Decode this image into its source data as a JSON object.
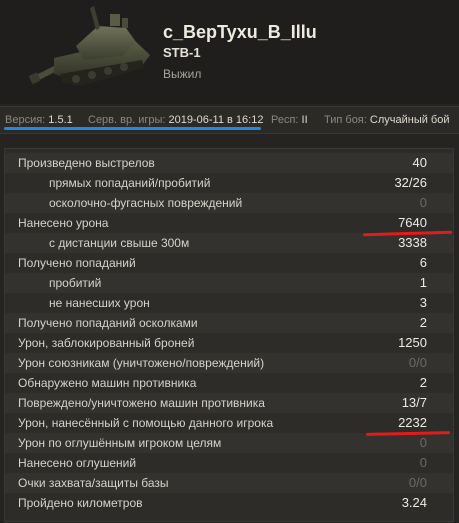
{
  "header": {
    "player_name": "c_BepTyxu_B_Illu",
    "tank_name": "STB-1",
    "status": "Выжил"
  },
  "info": {
    "version_label": "Версия:",
    "version_value": "1.5.1",
    "server_time_label": "Серв. вр. игры:",
    "server_time_value": "2019-06-11 в 16:12",
    "resp_label": "Респ:",
    "resp_value": "II",
    "battle_type_label": "Тип боя:",
    "battle_type_value": "Случайный бой"
  },
  "stats": [
    {
      "label": "Произведено выстрелов",
      "value": "40"
    },
    {
      "label": "прямых попаданий/пробитий",
      "value": "32/26"
    },
    {
      "label": "осколочно-фугасных повреждений",
      "value": "0"
    },
    {
      "label": "Нанесено урона",
      "value": "7640"
    },
    {
      "label": "с дистанции свыше 300м",
      "value": "3338"
    },
    {
      "label": "Получено попаданий",
      "value": "6"
    },
    {
      "label": "пробитий",
      "value": "1"
    },
    {
      "label": "не нанесших урон",
      "value": "3"
    },
    {
      "label": "Получено попаданий осколками",
      "value": "2"
    },
    {
      "label": "Урон, заблокированный броней",
      "value": "1250"
    },
    {
      "label": "Урон союзникам (уничтожено/повреждений)",
      "value": "0/0"
    },
    {
      "label": "Обнаружено машин противника",
      "value": "2"
    },
    {
      "label": "Повреждено/уничтожено машин противника",
      "value": "13/7"
    },
    {
      "label": "Урон, нанесённый с помощью данного игрока",
      "value": "2232"
    },
    {
      "label": "Урон по оглушённым игроком целям",
      "value": "0"
    },
    {
      "label": "Нанесено оглушений",
      "value": "0"
    },
    {
      "label": "Очки захвата/защиты базы",
      "value": "0/0"
    },
    {
      "label": "Пройдено километров",
      "value": "3.24"
    }
  ],
  "colors": {
    "underline_blue": "#2288e0",
    "underline_red": "#e21b1b"
  }
}
